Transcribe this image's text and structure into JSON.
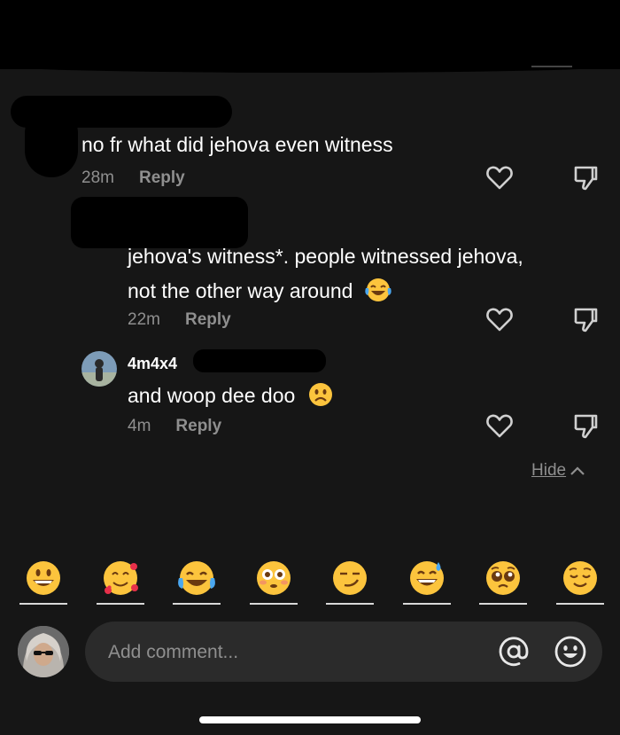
{
  "comments": [
    {
      "text": "no fr what did jehova even witness",
      "time": "28m",
      "reply_label": "Reply"
    },
    {
      "text_line1": "jehova's witness*. people witnessed jehova,",
      "text_line2": "not the other way around",
      "emoji": "face-with-tears-of-joy",
      "time": "22m",
      "reply_label": "Reply"
    },
    {
      "username": "4m4x4",
      "text": "and woop dee doo",
      "emoji": "frowning-face",
      "time": "4m",
      "reply_label": "Reply"
    }
  ],
  "hide_label": "Hide",
  "emoji_bar": [
    "grinning-face",
    "smiling-face-with-hearts",
    "face-with-tears-of-joy",
    "flushed-face",
    "smirking-face",
    "grinning-face-with-sweat",
    "pleading-face",
    "relieved-face"
  ],
  "composer": {
    "placeholder": "Add comment...",
    "mention_icon": "at-icon",
    "emoji_icon": "smiley-icon"
  },
  "colors": {
    "background": "#161616",
    "muted_text": "#8f8f8f",
    "input_bg": "#2b2b2b"
  }
}
